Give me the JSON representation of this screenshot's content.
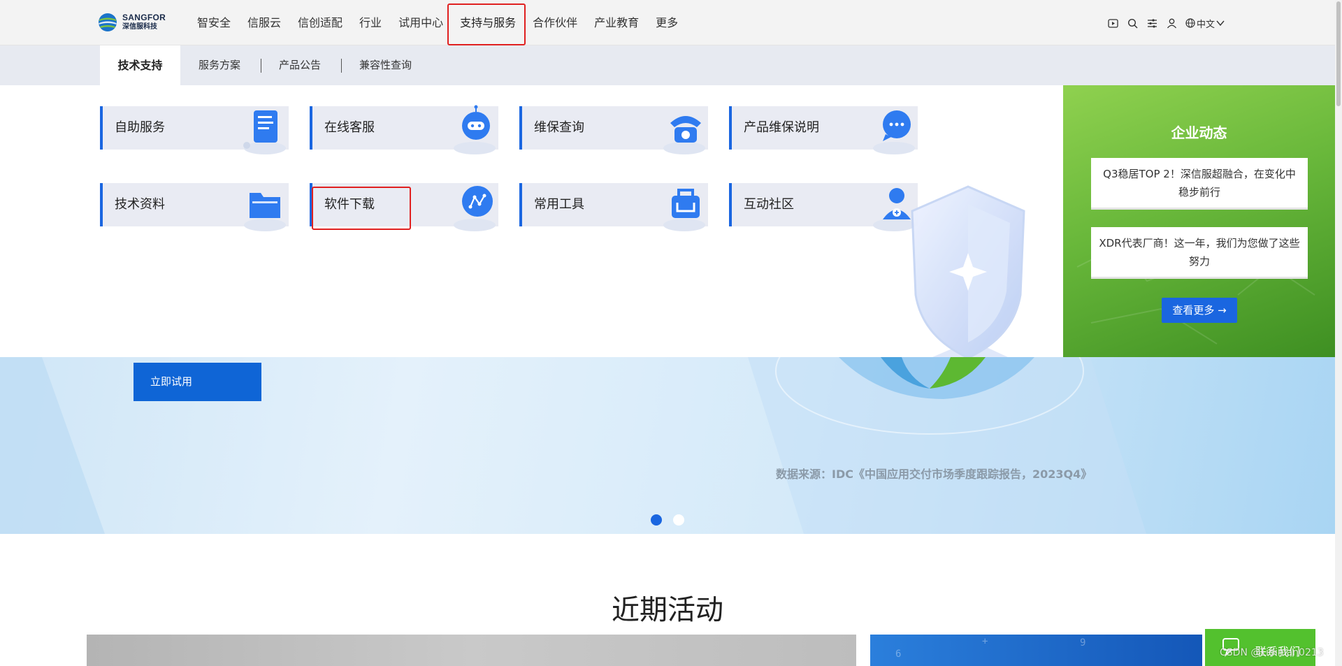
{
  "brand": {
    "name_en": "SANGFOR",
    "name_cn": "深信服科技"
  },
  "nav": {
    "items": [
      "智安全",
      "信服云",
      "信创适配",
      "行业",
      "试用中心",
      "支持与服务",
      "合作伙伴",
      "产业教育",
      "更多"
    ],
    "active": "支持与服务",
    "language": "中文"
  },
  "subnav": {
    "tabs": [
      "技术支持",
      "服务方案",
      "产品公告",
      "兼容性查询"
    ],
    "active": "技术支持"
  },
  "menu": {
    "cards": [
      {
        "label": "自助服务",
        "icon": "document-icon"
      },
      {
        "label": "在线客服",
        "icon": "robot-icon"
      },
      {
        "label": "维保查询",
        "icon": "telephone-icon"
      },
      {
        "label": "产品维保说明",
        "icon": "chat-bubble-icon"
      },
      {
        "label": "技术资料",
        "icon": "folder-icon"
      },
      {
        "label": "软件下载",
        "icon": "share-node-icon"
      },
      {
        "label": "常用工具",
        "icon": "toolbox-icon"
      },
      {
        "label": "互动社区",
        "icon": "community-user-icon"
      }
    ],
    "highlighted": "软件下载"
  },
  "news": {
    "title": "企业动态",
    "items": [
      "Q3稳居TOP 2！深信服超融合，在变化中稳步前行",
      "XDR代表厂商！这一年，我们为您做了这些努力"
    ],
    "more_label": "查看更多 →"
  },
  "hero": {
    "try_label": "立即试用",
    "source": "数据来源：IDC《中国应用交付市场季度跟踪报告，2023Q4》",
    "active_slide": 1,
    "slides": 2
  },
  "activities": {
    "title": "近期活动"
  },
  "contact": {
    "label": "联系我们"
  },
  "watermark": "CSDN @Lidinian0213",
  "colors": {
    "accent": "#1a66e0",
    "highlight": "#e02020",
    "news_green": "#68b73a",
    "contact_green": "#53c12e"
  }
}
